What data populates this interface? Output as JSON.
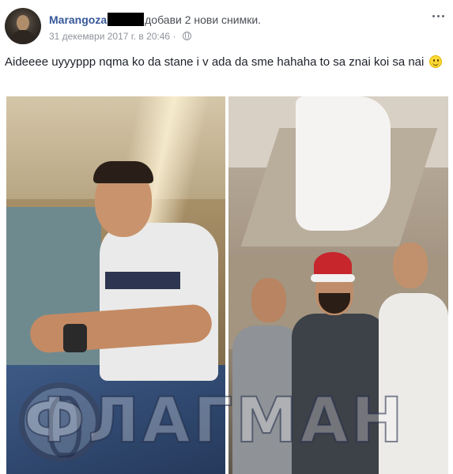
{
  "post": {
    "author": "Marangoza",
    "action": "добави 2 нови снимки.",
    "timestamp": "31 декември 2017 г. в 20:46",
    "separator": "·",
    "privacy_icon": "globe-icon",
    "more_icon": "more-options-icon",
    "text": "Aideeee uyyyppp nqma ko da stane i v ada da sme hahaha to sa znai koi sa nai",
    "emoji": "smile-emoji",
    "photos_count": 2
  },
  "watermark": {
    "text": "ФЛАГМАН"
  },
  "colors": {
    "author_link": "#365899",
    "meta_text": "#90949c",
    "body_text": "#1d2129"
  }
}
